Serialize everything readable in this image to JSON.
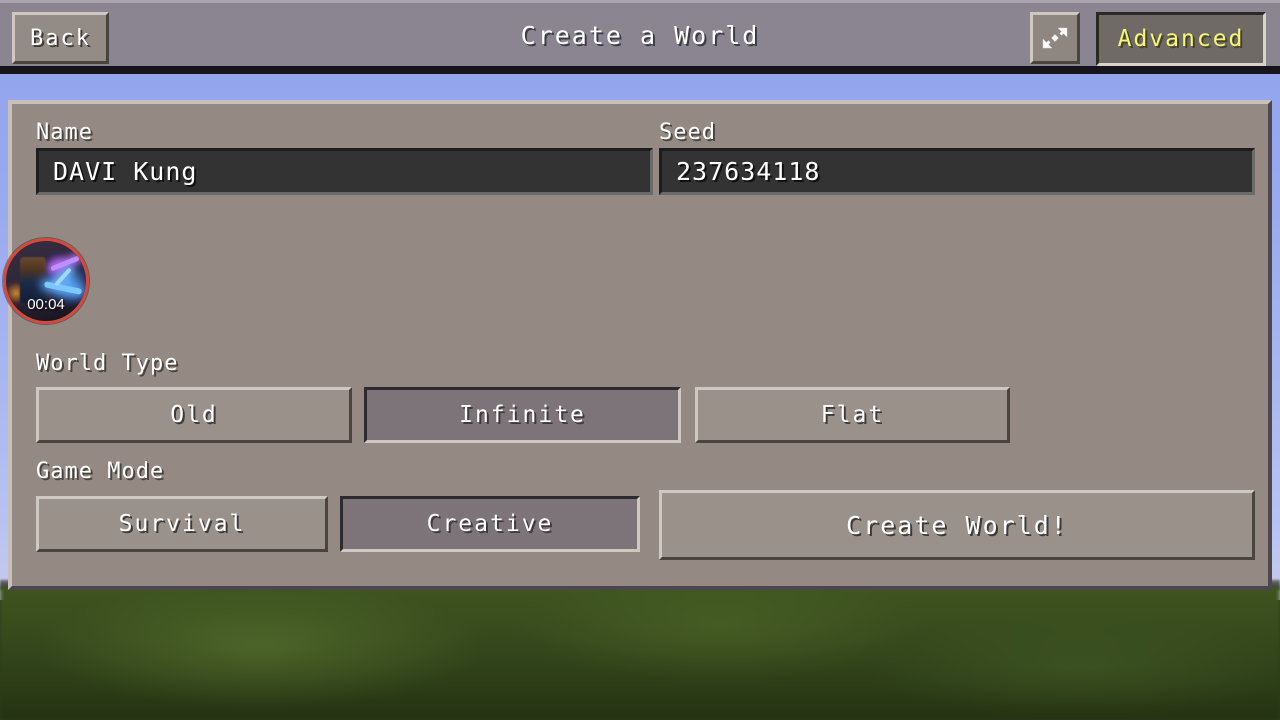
{
  "header": {
    "back_label": "Back",
    "title": "Create a World",
    "resize_icon": "diagonal-double-arrow-icon",
    "advanced_label": "Advanced"
  },
  "form": {
    "name": {
      "label": "Name",
      "value": "DAVI Kung",
      "placeholder": "Name"
    },
    "seed": {
      "label": "Seed",
      "value": "237634118",
      "placeholder": "Seed"
    }
  },
  "world_type": {
    "label": "World Type",
    "options": [
      {
        "label": "Old",
        "selected": false
      },
      {
        "label": "Infinite",
        "selected": true
      },
      {
        "label": "Flat",
        "selected": false
      }
    ]
  },
  "game_mode": {
    "label": "Game Mode",
    "options": [
      {
        "label": "Survival",
        "selected": false
      },
      {
        "label": "Creative",
        "selected": true
      }
    ]
  },
  "actions": {
    "create_world_label": "Create World!"
  },
  "overlay": {
    "webcam_timer": "00:04"
  },
  "colors": {
    "panel_bg": "#948a83",
    "header_bg": "#8a8590",
    "button_bg": "#9a918b",
    "button_selected_bg": "#7c7478",
    "field_bg": "#333333",
    "advanced_text": "#f7f57a",
    "record_ring": "#d6483c",
    "text": "#ffffff"
  }
}
